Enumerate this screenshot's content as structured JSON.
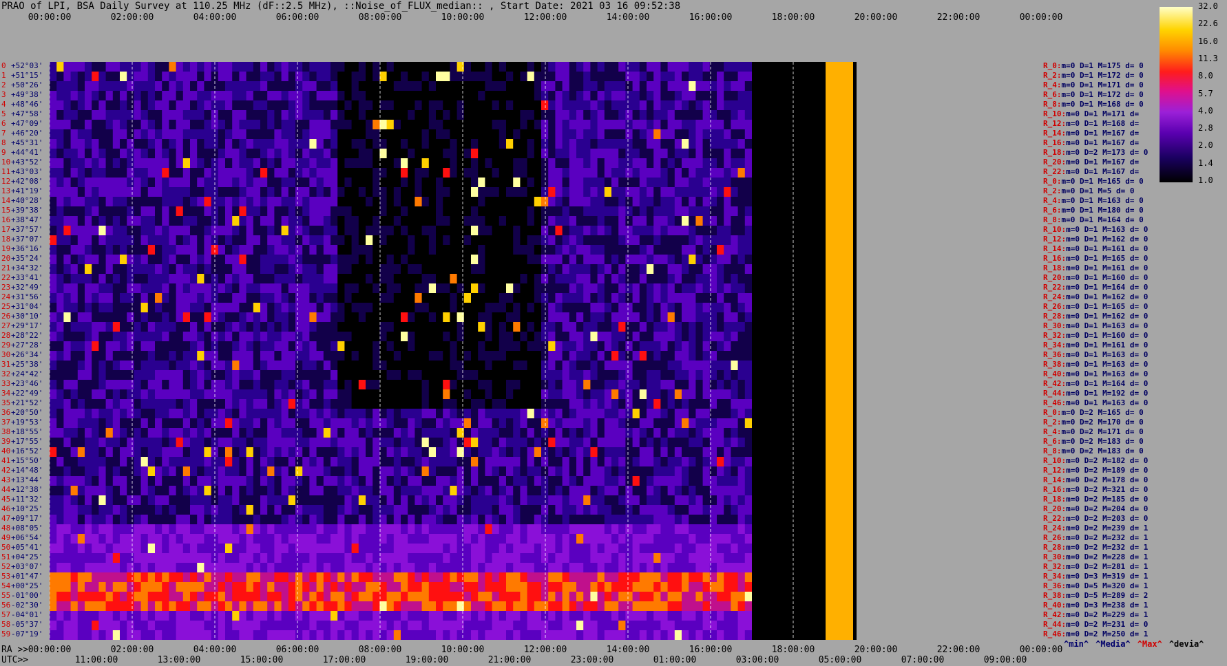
{
  "title": "PRAO of LPI, BSA Daily Survey at 110.25 MHz (dF::2.5 MHz), ::Noise_of_FLUX_median:: , Start Date: 2021 03 16 09:52:38",
  "chart_data": {
    "type": "heatmap",
    "top_axis_ticks": [
      "00:00:00",
      "02:00:00",
      "04:00:00",
      "06:00:00",
      "08:00:00",
      "10:00:00",
      "12:00:00",
      "14:00:00",
      "16:00:00",
      "18:00:00",
      "20:00:00",
      "22:00:00",
      "00:00:00"
    ],
    "ra_axis_label": "RA >>",
    "ra_axis_ticks": [
      "00:00:00",
      "02:00:00",
      "04:00:00",
      "06:00:00",
      "08:00:00",
      "10:00:00",
      "12:00:00",
      "14:00:00",
      "16:00:00",
      "18:00:00",
      "20:00:00",
      "22:00:00",
      "00:00:00"
    ],
    "utc_axis_label": "UTC>>",
    "utc_axis_ticks": [
      "11:00:00",
      "13:00:00",
      "15:00:00",
      "17:00:00",
      "19:00:00",
      "21:00:00",
      "23:00:00",
      "01:00:00",
      "03:00:00",
      "05:00:00",
      "07:00:00",
      "09:00:00"
    ],
    "colorbar_ticks": [
      "32.0",
      "22.6",
      "16.0",
      "11.3",
      "8.0",
      "5.7",
      "4.0",
      "2.8",
      "2.0",
      "1.4",
      "1.0"
    ],
    "declinations": [
      {
        "n": "0",
        "d": "+52°03'"
      },
      {
        "n": "1",
        "d": "+51°15'"
      },
      {
        "n": "2",
        "d": "+50°26'"
      },
      {
        "n": "3",
        "d": "+49°38'"
      },
      {
        "n": "4",
        "d": "+48°46'"
      },
      {
        "n": "5",
        "d": "+47°58'"
      },
      {
        "n": "6",
        "d": "+47°09'"
      },
      {
        "n": "7",
        "d": "+46°20'"
      },
      {
        "n": "8",
        "d": "+45°31'"
      },
      {
        "n": "9",
        "d": "+44°41'"
      },
      {
        "n": "10",
        "d": "+43°52'"
      },
      {
        "n": "11",
        "d": "+43°03'"
      },
      {
        "n": "12",
        "d": "+42°08'"
      },
      {
        "n": "13",
        "d": "+41°19'"
      },
      {
        "n": "14",
        "d": "+40°28'"
      },
      {
        "n": "15",
        "d": "+39°38'"
      },
      {
        "n": "16",
        "d": "+38°47'"
      },
      {
        "n": "17",
        "d": "+37°57'"
      },
      {
        "n": "18",
        "d": "+37°07'"
      },
      {
        "n": "19",
        "d": "+36°16'"
      },
      {
        "n": "20",
        "d": "+35°24'"
      },
      {
        "n": "21",
        "d": "+34°32'"
      },
      {
        "n": "22",
        "d": "+33°41'"
      },
      {
        "n": "23",
        "d": "+32°49'"
      },
      {
        "n": "24",
        "d": "+31°56'"
      },
      {
        "n": "25",
        "d": "+31°04'"
      },
      {
        "n": "26",
        "d": "+30°10'"
      },
      {
        "n": "27",
        "d": "+29°17'"
      },
      {
        "n": "28",
        "d": "+28°22'"
      },
      {
        "n": "29",
        "d": "+27°28'"
      },
      {
        "n": "30",
        "d": "+26°34'"
      },
      {
        "n": "31",
        "d": "+25°38'"
      },
      {
        "n": "32",
        "d": "+24°42'"
      },
      {
        "n": "33",
        "d": "+23°46'"
      },
      {
        "n": "34",
        "d": "+22°49'"
      },
      {
        "n": "35",
        "d": "+21°52'"
      },
      {
        "n": "36",
        "d": "+20°50'"
      },
      {
        "n": "37",
        "d": "+19°53'"
      },
      {
        "n": "38",
        "d": "+18°55'"
      },
      {
        "n": "39",
        "d": "+17°55'"
      },
      {
        "n": "40",
        "d": "+16°52'"
      },
      {
        "n": "41",
        "d": "+15°50'"
      },
      {
        "n": "42",
        "d": "+14°48'"
      },
      {
        "n": "43",
        "d": "+13°44'"
      },
      {
        "n": "44",
        "d": "+12°38'"
      },
      {
        "n": "45",
        "d": "+11°32'"
      },
      {
        "n": "46",
        "d": "+10°25'"
      },
      {
        "n": "47",
        "d": "+09°17'"
      },
      {
        "n": "48",
        "d": "+08°05'"
      },
      {
        "n": "49",
        "d": "+06°54'"
      },
      {
        "n": "50",
        "d": "+05°41'"
      },
      {
        "n": "51",
        "d": "+04°25'"
      },
      {
        "n": "52",
        "d": "+03°07'"
      },
      {
        "n": "53",
        "d": "+01°47'"
      },
      {
        "n": "54",
        "d": "+00°25'"
      },
      {
        "n": "55",
        "d": "-01°00'"
      },
      {
        "n": "56",
        "d": "-02°30'"
      },
      {
        "n": "57",
        "d": "-04°01'"
      },
      {
        "n": "58",
        "d": "-05°37'"
      },
      {
        "n": "59",
        "d": "-07°19'"
      }
    ],
    "stats": [
      {
        "k": "R_0:",
        "v": "m=0 D=1 M=175 d= 0"
      },
      {
        "k": "R_2:",
        "v": "m=0 D=1 M=172 d= 0"
      },
      {
        "k": "R_4:",
        "v": "m=0 D=1 M=171 d= 0"
      },
      {
        "k": "R_6:",
        "v": "m=0 D=1 M=172 d= 0"
      },
      {
        "k": "R_8:",
        "v": "m=0 D=1 M=168 d= 0"
      },
      {
        "k": "R_10:",
        "v": "m=0 D=1 M=171 d="
      },
      {
        "k": "R_12:",
        "v": "m=0 D=1 M=168 d="
      },
      {
        "k": "R_14:",
        "v": "m=0 D=1 M=167 d="
      },
      {
        "k": "R_16:",
        "v": "m=0 D=1 M=167 d="
      },
      {
        "k": "R_18:",
        "v": "m=0 D=2 M=173 d= 0"
      },
      {
        "k": "R_20:",
        "v": "m=0 D=1 M=167 d="
      },
      {
        "k": "R_22:",
        "v": "m=0 D=1 M=167 d="
      },
      {
        "k": "R_0:",
        "v": "m=0 D=1 M=165 d= 0"
      },
      {
        "k": "R_2:",
        "v": "m=0 D=1 M=5 d= 0"
      },
      {
        "k": "R_4:",
        "v": "m=0 D=1 M=163 d= 0"
      },
      {
        "k": "R_6:",
        "v": "m=0 D=1 M=180 d= 0"
      },
      {
        "k": "R_8:",
        "v": "m=0 D=1 M=164 d= 0"
      },
      {
        "k": "R_10:",
        "v": "m=0 D=1 M=163 d= 0"
      },
      {
        "k": "R_12:",
        "v": "m=0 D=1 M=162 d= 0"
      },
      {
        "k": "R_14:",
        "v": "m=0 D=1 M=161 d= 0"
      },
      {
        "k": "R_16:",
        "v": "m=0 D=1 M=165 d= 0"
      },
      {
        "k": "R_18:",
        "v": "m=0 D=1 M=161 d= 0"
      },
      {
        "k": "R_20:",
        "v": "m=0 D=1 M=160 d= 0"
      },
      {
        "k": "R_22:",
        "v": "m=0 D=1 M=164 d= 0"
      },
      {
        "k": "R_24:",
        "v": "m=0 D=1 M=162 d= 0"
      },
      {
        "k": "R_26:",
        "v": "m=0 D=1 M=165 d= 0"
      },
      {
        "k": "R_28:",
        "v": "m=0 D=1 M=162 d= 0"
      },
      {
        "k": "R_30:",
        "v": "m=0 D=1 M=163 d= 0"
      },
      {
        "k": "R_32:",
        "v": "m=0 D=1 M=160 d= 0"
      },
      {
        "k": "R_34:",
        "v": "m=0 D=1 M=161 d= 0"
      },
      {
        "k": "R_36:",
        "v": "m=0 D=1 M=163 d= 0"
      },
      {
        "k": "R_38:",
        "v": "m=0 D=1 M=163 d= 0"
      },
      {
        "k": "R_40:",
        "v": "m=0 D=1 M=163 d= 0"
      },
      {
        "k": "R_42:",
        "v": "m=0 D=1 M=164 d= 0"
      },
      {
        "k": "R_44:",
        "v": "m=0 D=1 M=192 d= 0"
      },
      {
        "k": "R_46:",
        "v": "m=0 D=1 M=163 d= 0"
      },
      {
        "k": "R_0:",
        "v": "m=0 D=2 M=165 d= 0"
      },
      {
        "k": "R_2:",
        "v": "m=0 D=2 M=170 d= 0"
      },
      {
        "k": "R_4:",
        "v": "m=0 D=2 M=171 d= 0"
      },
      {
        "k": "R_6:",
        "v": "m=0 D=2 M=183 d= 0"
      },
      {
        "k": "R_8:",
        "v": "m=0 D=2 M=183 d= 0"
      },
      {
        "k": "R_10:",
        "v": "m=0 D=2 M=182 d= 0"
      },
      {
        "k": "R_12:",
        "v": "m=0 D=2 M=189 d= 0"
      },
      {
        "k": "R_14:",
        "v": "m=0 D=2 M=178 d= 0"
      },
      {
        "k": "R_16:",
        "v": "m=0 D=2 M=321 d= 0"
      },
      {
        "k": "R_18:",
        "v": "m=0 D=2 M=185 d= 0"
      },
      {
        "k": "R_20:",
        "v": "m=0 D=2 M=204 d= 0"
      },
      {
        "k": "R_22:",
        "v": "m=0 D=2 M=203 d= 0"
      },
      {
        "k": "R_24:",
        "v": "m=0 D=2 M=239 d= 1"
      },
      {
        "k": "R_26:",
        "v": "m=0 D=2 M=232 d= 1"
      },
      {
        "k": "R_28:",
        "v": "m=0 D=2 M=232 d= 1"
      },
      {
        "k": "R_30:",
        "v": "m=0 D=2 M=228 d= 1"
      },
      {
        "k": "R_32:",
        "v": "m=0 D=2 M=281 d= 1"
      },
      {
        "k": "R_34:",
        "v": "m=0 D=3 M=319 d= 1"
      },
      {
        "k": "R_36:",
        "v": "m=0 D=5 M=320 d= 1"
      },
      {
        "k": "R_38:",
        "v": "m=0 D=5 M=289 d= 2"
      },
      {
        "k": "R_40:",
        "v": "m=0 D=3 M=238 d= 1"
      },
      {
        "k": "R_42:",
        "v": "m=0 D=2 M=229 d= 1"
      },
      {
        "k": "R_44:",
        "v": "m=0 D=2 M=231 d= 0"
      },
      {
        "k": "R_46:",
        "v": "m=0 D=2 M=250 d= 1"
      }
    ],
    "legend": [
      "^min^",
      "^Media^",
      "^Max^",
      "^devia^"
    ],
    "legend_colors": [
      "#00006a",
      "#00006a",
      "#d00000",
      "#000000"
    ]
  }
}
